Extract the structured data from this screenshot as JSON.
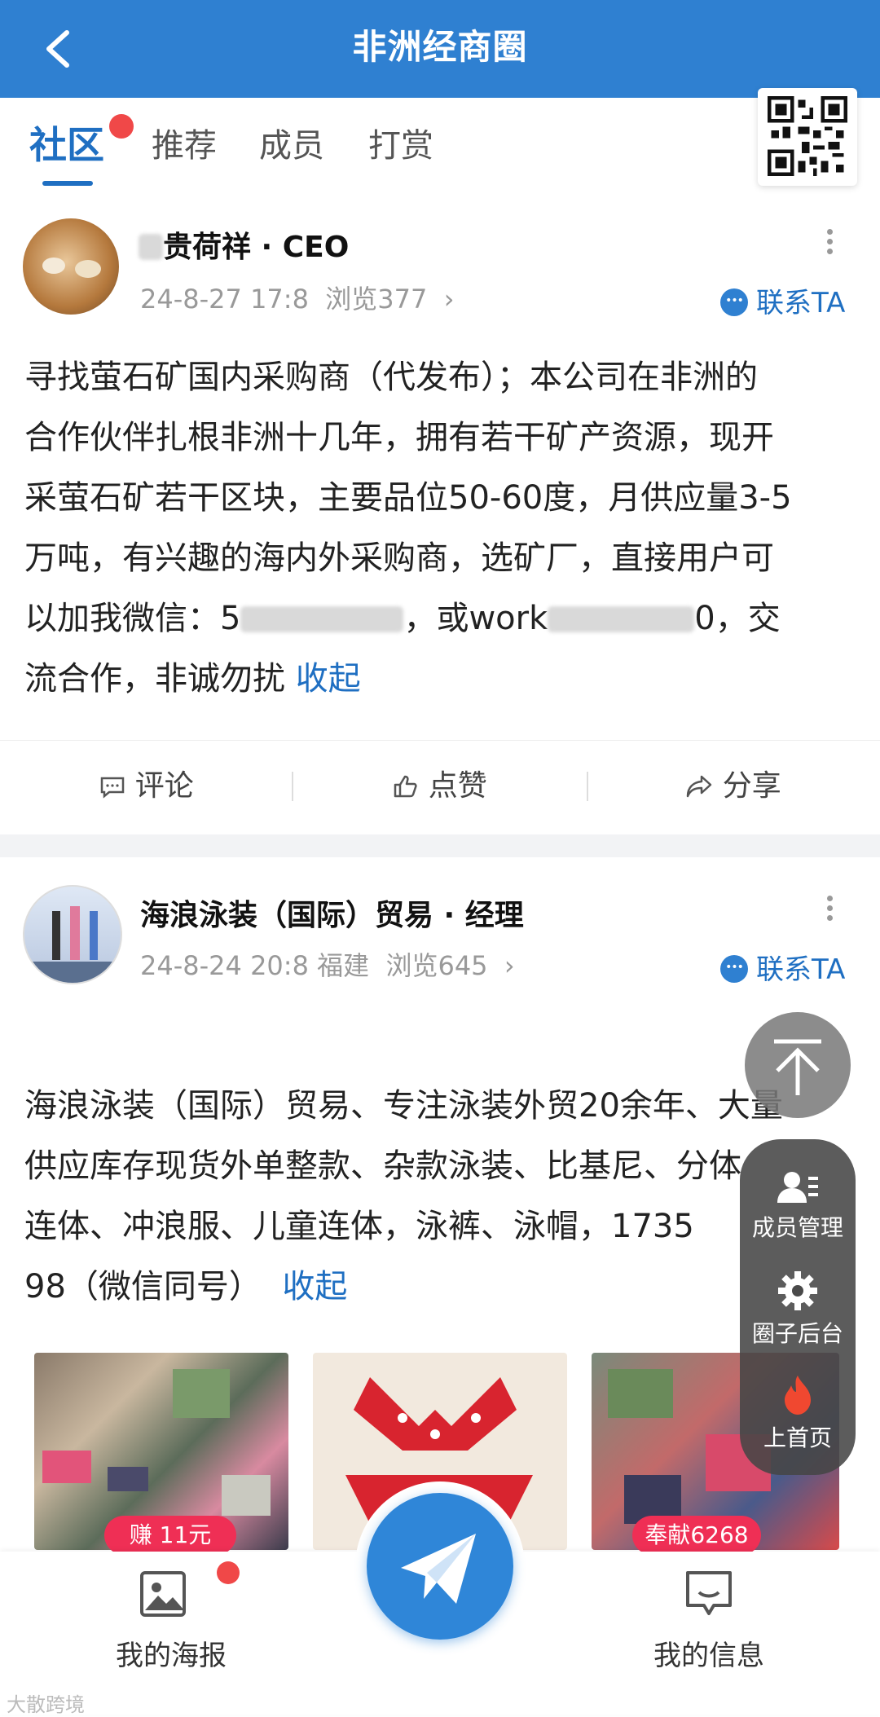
{
  "header": {
    "title": "非洲经商圈",
    "back_icon": "chevron-left-icon"
  },
  "tabs": [
    {
      "label": "社区",
      "active": true,
      "has_dot": true
    },
    {
      "label": "推荐"
    },
    {
      "label": "成员"
    },
    {
      "label": "打赏"
    }
  ],
  "posts": [
    {
      "author": "贵荷祥 · CEO",
      "date": "24-8-27 17:8",
      "location": "",
      "views": "浏览377",
      "contact": "联系TA",
      "body_lines": [
        "寻找萤石矿国内采购商（代发布）；本公司在非洲的",
        "合作伙伴扎根非洲十几年，拥有若干矿产资源，现开",
        "采萤石矿若干区块，主要品位50-60度，月供应量3-5",
        "万吨，有兴趣的海内外采购商，选矿厂，直接用户可"
      ],
      "line5_a": "以加我微信：5",
      "line5_b": "，或work",
      "line5_c": "0，交",
      "line6": "流合作，非诚勿扰",
      "collapse": "收起",
      "actions": {
        "comment": "评论",
        "like": "点赞",
        "share": "分享"
      }
    },
    {
      "author": "海浪泳装（国际）贸易 · 经理",
      "date": "24-8-24 20:8",
      "location": "福建",
      "views": "浏览645",
      "contact": "联系TA",
      "body_lines": [
        "海浪泳装（国际）贸易、专注泳装外贸20余年、大量",
        "供应库存现货外单整款、杂款泳装、比基尼、分体",
        "连体、冲浪服、儿童连体，泳裤、泳帽，1735"
      ],
      "line4": "98（微信同号）",
      "collapse": "收起",
      "badges": {
        "left": "赚 11元",
        "right": "奉献6268"
      }
    }
  ],
  "side_panel": {
    "to_top_icon": "arrow-up-to-top-icon",
    "items": [
      {
        "label": "成员管理",
        "icon": "member-manage-icon"
      },
      {
        "label": "圈子后台",
        "icon": "gear-icon"
      },
      {
        "label": "上首页",
        "icon": "fire-icon"
      }
    ]
  },
  "bottom_nav": {
    "left": {
      "label": "我的海报",
      "icon": "image-icon",
      "has_dot": true
    },
    "center": {
      "icon": "paper-plane-icon"
    },
    "right": {
      "label": "我的信息",
      "icon": "message-icon"
    }
  },
  "watermark": "大散跨境",
  "colors": {
    "brand": "#2f80d1",
    "link": "#1f6fc2",
    "badge": "#ef2f55",
    "dot": "#f04848"
  }
}
